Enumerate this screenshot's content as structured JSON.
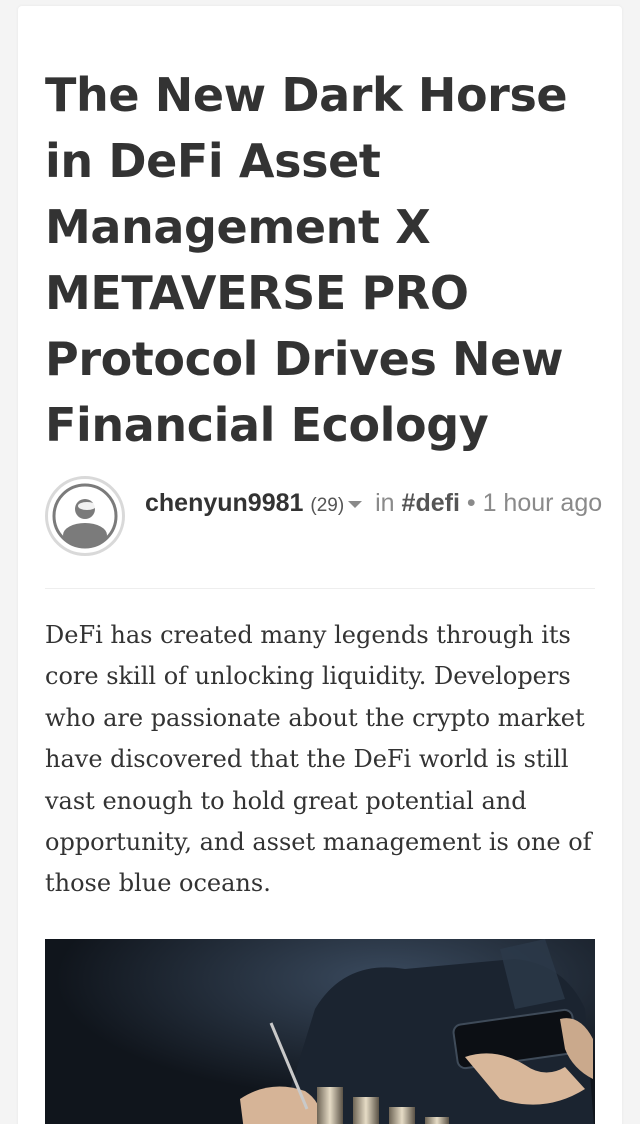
{
  "post": {
    "title": "The New Dark Horse in DeFi Asset Management X METAVERSE PRO Protocol Drives New Financial Ecology",
    "author": "chenyun9981",
    "reputation": "(29)",
    "in_label": "in",
    "tag": "#defi",
    "separator": "•",
    "time": "1 hour ago",
    "body": "DeFi has created many legends through its core skill of unlocking liquidity. Developers who are passionate about the crypto market have discovered that the DeFi world is still vast enough to hold great potential and opportunity, and asset management is one of those blue oceans."
  },
  "icons": {
    "avatar": "user-avatar-icon",
    "dropdown": "caret-down-icon"
  },
  "colors": {
    "background": "#f4f4f4",
    "card": "#ffffff",
    "title": "#333333",
    "meta": "#8a8a8a",
    "avatar_border": "#d9d9d9"
  }
}
